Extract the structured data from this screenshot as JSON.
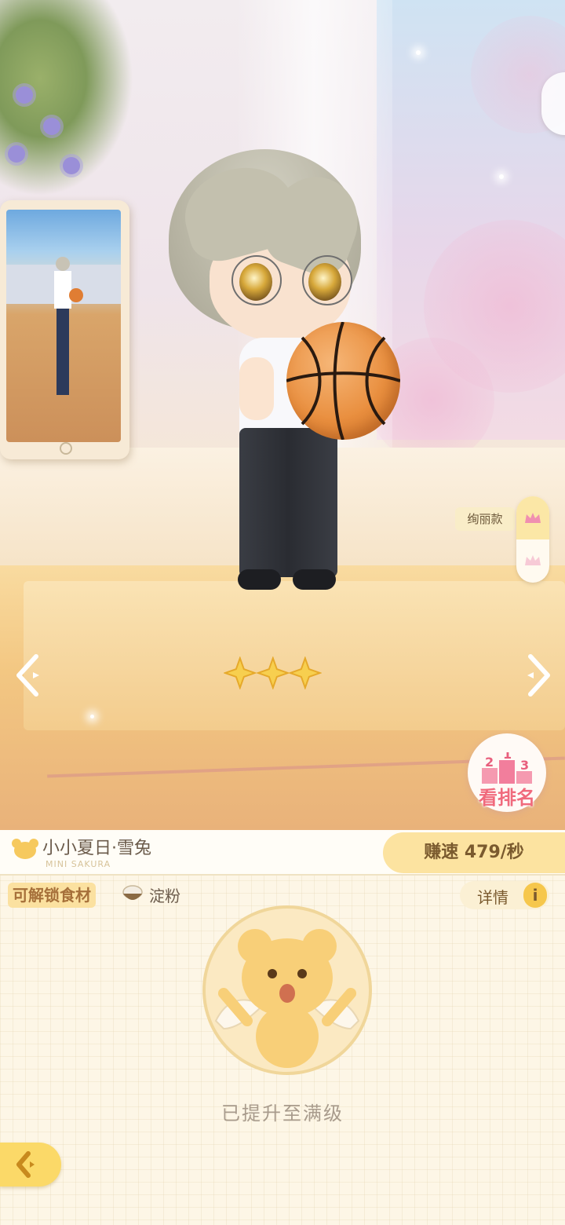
{
  "character": {
    "name": "小小夏日·雪兔",
    "subtitle": "MINI SAKURA",
    "speed": "赚速 479/秒",
    "stars": 3
  },
  "style_selector": {
    "label": "绚丽款"
  },
  "ranking_button": {
    "label": "看排名",
    "podium": [
      "2",
      "1",
      "3"
    ]
  },
  "unlock": {
    "tag": "可解锁食材",
    "ingredient": "淀粉",
    "details_label": "详情",
    "info_icon": "i",
    "status": "已提升至满级"
  },
  "icons": [
    "bear-head-icon",
    "crown-icon",
    "left-arrow-icon",
    "right-arrow-icon",
    "star-icon",
    "info-icon",
    "starch-bowl-icon",
    "kero-medal-icon",
    "back-icon"
  ],
  "colors": {
    "accent": "#fce3a0",
    "rank_pink": "#f06a7c",
    "panel_bg": "#fdf6e6"
  }
}
